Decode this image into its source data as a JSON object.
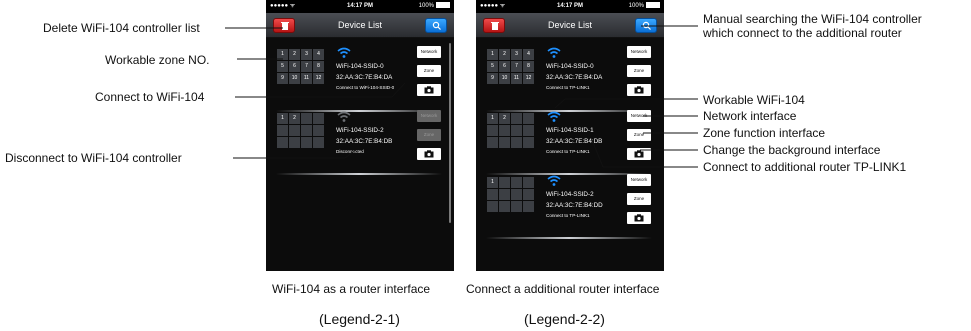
{
  "annotations_left": {
    "delete": "Delete WiFi-104 controller list",
    "zone_no": "Workable zone NO.",
    "connect": "Connect to WiFi-104",
    "disconnect": "Disconnect to WiFi-104 controller"
  },
  "annotations_right": {
    "manual_search_1": "Manual searching the WiFi-104 controller",
    "manual_search_2": "which connect to the additional router",
    "workable_wifi": "Workable WiFi-104",
    "network_interface": "Network interface",
    "zone_interface": "Zone function interface",
    "background_interface": "Change the background interface",
    "additional_router": "Connect to additional router TP-LINK1"
  },
  "captions": {
    "left": "WiFi-104 as a router interface",
    "right": "Connect a additional router interface",
    "legend_left": "(Legend-2-1)",
    "legend_right": "(Legend-2-2)"
  },
  "phone_left": {
    "status": {
      "signal": "●●●●● ᯤ",
      "time": "14:17 PM",
      "battery": "100%"
    },
    "title": "Device List",
    "devices": [
      {
        "zones": [
          "1",
          "2",
          "3",
          "4",
          "5",
          "6",
          "7",
          "8",
          "9",
          "10",
          "11",
          "12"
        ],
        "name": "WiFi-104-SSID-0",
        "mac": "32:AA:3C:7E:B4:DA",
        "status": "Connect to WiFi-104-SSID-0",
        "network": "Network",
        "zone": "Zone",
        "active": true
      },
      {
        "zones": [
          "1",
          "2",
          "",
          "",
          "",
          "",
          "",
          "",
          "",
          "",
          "",
          ""
        ],
        "name": "WiFi-104-SSID-2",
        "mac": "32:AA:3C:7E:B4:DB",
        "status": "Disconnected",
        "network": "Network",
        "zone": "Zone",
        "active": false
      }
    ]
  },
  "phone_right": {
    "status": {
      "signal": "●●●●● ᯤ",
      "time": "14:17 PM",
      "battery": "100%"
    },
    "title": "Device List",
    "devices": [
      {
        "zones": [
          "1",
          "2",
          "3",
          "4",
          "5",
          "6",
          "7",
          "8",
          "9",
          "10",
          "11",
          "12"
        ],
        "name": "WiFi-104-SSID-0",
        "mac": "32:AA:3C:7E:B4:DA",
        "status": "Connect to TP-LINK1",
        "network": "Network",
        "zone": "Zone"
      },
      {
        "zones": [
          "1",
          "2",
          "",
          "",
          "",
          "",
          "",
          "",
          "",
          "",
          "",
          ""
        ],
        "name": "WiFi-104-SSID-1",
        "mac": "32:AA:3C:7E:B4:DB",
        "status": "Connect to TP-LINK1",
        "network": "Network",
        "zone": "Zone"
      },
      {
        "zones": [
          "1",
          "",
          "",
          "",
          "",
          "",
          "",
          "",
          "",
          "",
          "",
          ""
        ],
        "name": "WiFi-104-SSID-2",
        "mac": "32:AA:3C:7E:B4:DD",
        "status": "Connect to TP-LINK1",
        "network": "Network",
        "zone": "Zone"
      }
    ]
  },
  "colors": {
    "delete_button": "#d92323",
    "search_button": "#1b8cf0",
    "wifi_icon": "#1e90ff",
    "phone_bg": "#0c0c0c"
  },
  "icons": {
    "delete": "trash-icon",
    "search": "search-icon",
    "wifi": "wifi-icon",
    "camera": "camera-icon"
  }
}
